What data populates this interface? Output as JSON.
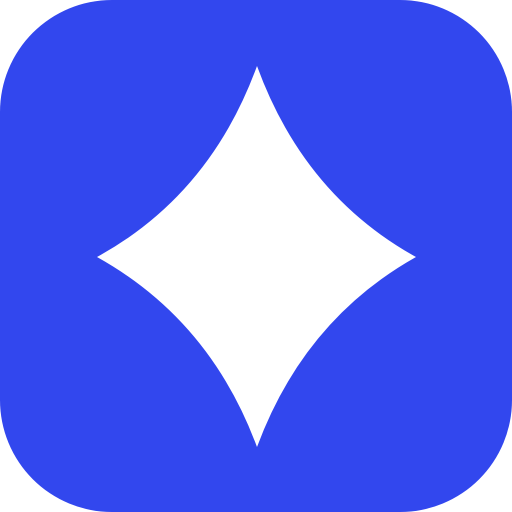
{
  "icon": {
    "name": "four-point-sparkle-star",
    "background_color": "#3247EE",
    "symbol_color": "#FFFFFF"
  }
}
